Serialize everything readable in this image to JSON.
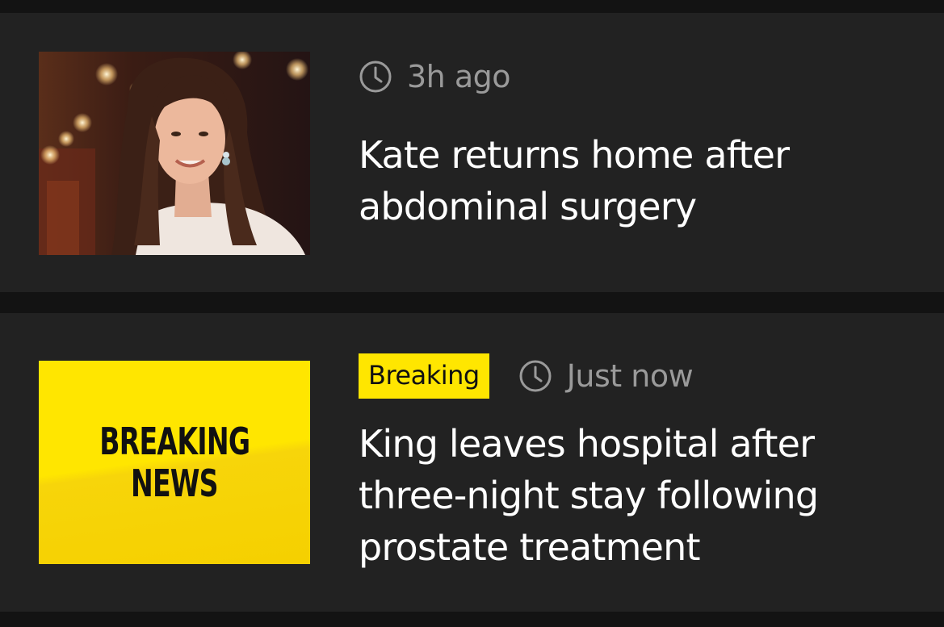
{
  "articles": [
    {
      "time": "3h ago",
      "headline": "Kate returns home after abdominal surgery",
      "image": "photo-of-woman-smiling"
    },
    {
      "badge": "Breaking",
      "time": "Just now",
      "headline": "King leaves hospital after three-night stay following prostate treatment",
      "image_text_line1": "BREAKING",
      "image_text_line2": "NEWS"
    }
  ],
  "colors": {
    "background": "#131313",
    "card": "#222222",
    "badge": "#ffe600",
    "time_text": "#9a9a9a",
    "headline_text": "#ffffff"
  }
}
